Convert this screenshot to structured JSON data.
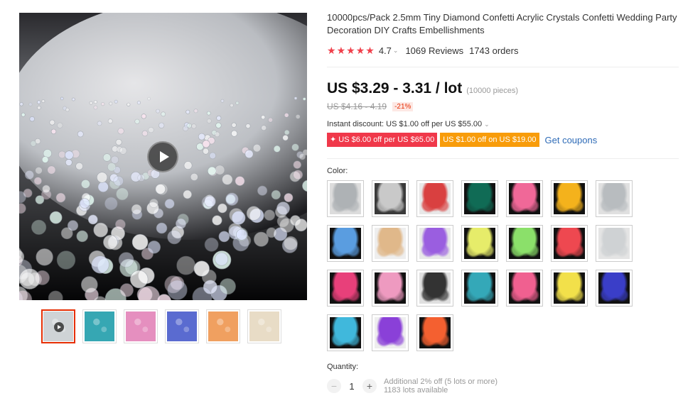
{
  "product": {
    "title": "10000pcs/Pack 2.5mm Tiny Diamond Confetti Acrylic Crystals Confetti Wedding Party Decoration DIY Crafts Embellishments",
    "rating_value": "4.7",
    "stars": 5,
    "reviews": "1069 Reviews",
    "orders": "1743 orders"
  },
  "pricing": {
    "price": "US $3.29 - 3.31 / lot",
    "pieces_note": "(10000 pieces)",
    "original_price": "US $4.16 - 4.19",
    "discount": "-21%",
    "instant_discount": "Instant discount: US $1.00 off per US $55.00",
    "coupons": [
      {
        "label": "✦ US $6.00 off per US $65.00",
        "color": "#f0384a"
      },
      {
        "label": "US $1.00 off on US $19.00",
        "color": "#f89c0a"
      }
    ],
    "get_coupons": "Get coupons"
  },
  "gallery": {
    "thumbnails": [
      {
        "name": "thumb-clear-video",
        "color": "#cfd3d6",
        "active": true,
        "video": true
      },
      {
        "name": "thumb-teal",
        "color": "#36a7b3",
        "active": false,
        "video": false
      },
      {
        "name": "thumb-pink",
        "color": "#e58fbf",
        "active": false,
        "video": false
      },
      {
        "name": "thumb-multicolor",
        "color": "#5a6bd0",
        "active": false,
        "video": false
      },
      {
        "name": "thumb-orange-hand",
        "color": "#f0a060",
        "active": false,
        "video": false
      },
      {
        "name": "thumb-bag",
        "color": "#e8dcc6",
        "active": false,
        "video": false
      }
    ]
  },
  "color": {
    "label": "Color:",
    "swatches": [
      {
        "name": "clear",
        "bg": "#dcdcdc",
        "fg": "#aeb2b5",
        "dark": false
      },
      {
        "name": "silver",
        "bg": "#3a3a3a",
        "fg": "#c9c9c9",
        "dark": true
      },
      {
        "name": "red",
        "bg": "#e8e8e8",
        "fg": "#d94040",
        "dark": false
      },
      {
        "name": "dark-green",
        "bg": "#111",
        "fg": "#106b55",
        "dark": true
      },
      {
        "name": "hot-pink",
        "bg": "#111",
        "fg": "#f06898",
        "dark": true
      },
      {
        "name": "gold",
        "bg": "#111",
        "fg": "#f4b21c",
        "dark": true
      },
      {
        "name": "clear-2",
        "bg": "#e0e0e0",
        "fg": "#b8bcbf",
        "dark": false
      },
      {
        "name": "light-blue",
        "bg": "#111",
        "fg": "#5a9de0",
        "dark": true
      },
      {
        "name": "champagne",
        "bg": "#eee",
        "fg": "#e0b88a",
        "dark": false
      },
      {
        "name": "purple",
        "bg": "#e8e8e8",
        "fg": "#9a5ee0",
        "dark": false
      },
      {
        "name": "yellow-green",
        "bg": "#111",
        "fg": "#e6ec6a",
        "dark": true
      },
      {
        "name": "green",
        "bg": "#111",
        "fg": "#8be06a",
        "dark": true
      },
      {
        "name": "coral",
        "bg": "#111",
        "fg": "#ee4850",
        "dark": true
      },
      {
        "name": "white",
        "bg": "#e4e4e4",
        "fg": "#cfd2d4",
        "dark": false
      },
      {
        "name": "rose",
        "bg": "#111",
        "fg": "#e8407a",
        "dark": true
      },
      {
        "name": "light-pink",
        "bg": "#111",
        "fg": "#ee9ac0",
        "dark": true
      },
      {
        "name": "black",
        "bg": "#e0e0e0",
        "fg": "#333333",
        "dark": false
      },
      {
        "name": "teal",
        "bg": "#111",
        "fg": "#34a8b8",
        "dark": true
      },
      {
        "name": "pink",
        "bg": "#111",
        "fg": "#f06090",
        "dark": true
      },
      {
        "name": "yellow",
        "bg": "#111",
        "fg": "#f2e04a",
        "dark": true
      },
      {
        "name": "royal-blue",
        "bg": "#111",
        "fg": "#3a3ec8",
        "dark": true
      },
      {
        "name": "aqua",
        "bg": "#111",
        "fg": "#40b8dc",
        "dark": true
      },
      {
        "name": "violet",
        "bg": "#eee",
        "fg": "#8a40d8",
        "dark": false
      },
      {
        "name": "orange",
        "bg": "#111",
        "fg": "#f46030",
        "dark": true
      }
    ]
  },
  "quantity": {
    "label": "Quantity:",
    "minus": "−",
    "value": "1",
    "plus": "+",
    "note_line1": "Additional 2% off (5 lots or more)",
    "note_line2": "1183 lots available"
  }
}
